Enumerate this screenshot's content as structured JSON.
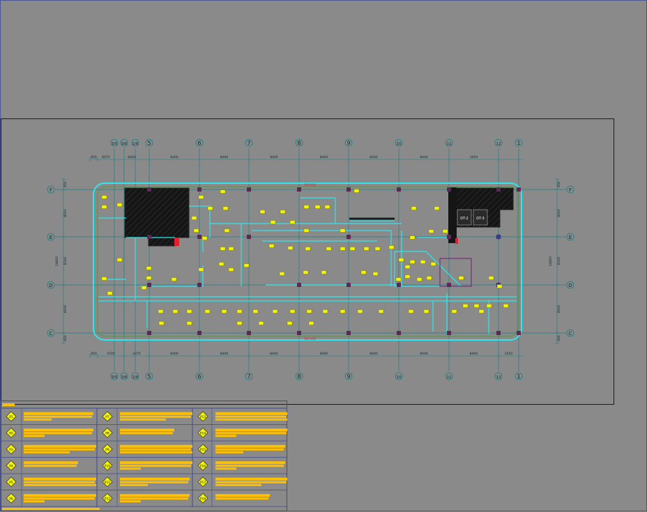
{
  "plan": {
    "top_axes": [
      {
        "id": "3/5",
        "label": "3/5"
      },
      {
        "id": "3/6",
        "label": "3/6"
      },
      {
        "id": "1/6",
        "label": "1/6"
      },
      {
        "id": "5",
        "label": "5"
      },
      {
        "id": "6",
        "label": "6"
      },
      {
        "id": "7",
        "label": "7"
      },
      {
        "id": "8",
        "label": "8"
      },
      {
        "id": "9",
        "label": "9"
      },
      {
        "id": "10",
        "label": "10"
      },
      {
        "id": "11",
        "label": "11"
      },
      {
        "id": "12",
        "label": "12"
      },
      {
        "id": "13",
        "label": "1"
      }
    ],
    "side_axes": [
      "F",
      "E",
      "D",
      "C"
    ],
    "top_dims": [
      "850",
      "6075",
      "8400",
      "8400",
      "8400",
      "8400",
      "8400",
      "8400",
      "8400",
      "3450"
    ],
    "bottom_dims": [
      "850",
      "4700",
      "4375",
      "8400",
      "8400",
      "8400",
      "8400",
      "8400",
      "8400",
      "8400",
      "3450"
    ],
    "left_dims": [
      "850",
      "8000",
      "8100",
      "8000",
      "850",
      "24800"
    ],
    "right_dims": [
      "850",
      "8000",
      "8100",
      "8000",
      "850",
      "24800"
    ],
    "elevator_labels": [
      "DT-2",
      "DT-3"
    ],
    "perimeter_labels": {
      "top": "RG-010",
      "bottom": "RG-010"
    },
    "fixture_tag": "P1"
  },
  "legend": {
    "rows": [
      [
        "P1",
        "P7",
        "P13"
      ],
      [
        "P2",
        "P8",
        "P14"
      ],
      [
        "P3",
        "P9",
        "P15"
      ],
      [
        "P4",
        "P10",
        "P16"
      ],
      [
        "P5",
        "P11",
        "P17"
      ],
      [
        "P6",
        "P12",
        "P18"
      ]
    ]
  },
  "colors": {
    "background": "#8a8a8a",
    "axis": "#1a7f86",
    "wall": "#2ee6ee",
    "fixture": "#f2f20a",
    "legend_bar": "#ffc000",
    "legend_grid": "#3f4a8c",
    "column": "#5a2a55",
    "accent_red": "#e0202c"
  }
}
